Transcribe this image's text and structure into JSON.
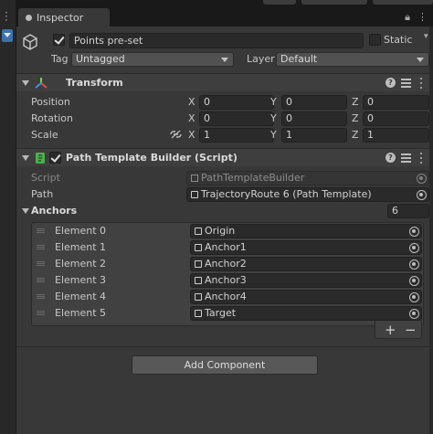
{
  "tab": {
    "title": "Inspector"
  },
  "object": {
    "name": "Points pre-set",
    "static_label": "Static",
    "tag_label": "Tag",
    "tag_value": "Untagged",
    "layer_label": "Layer",
    "layer_value": "Default"
  },
  "transform": {
    "title": "Transform",
    "rows": [
      {
        "label": "Position",
        "x": "0",
        "y": "0",
        "z": "0"
      },
      {
        "label": "Rotation",
        "x": "0",
        "y": "0",
        "z": "0"
      },
      {
        "label": "Scale",
        "x": "1",
        "y": "1",
        "z": "1"
      }
    ],
    "axis": {
      "x": "X",
      "y": "Y",
      "z": "Z"
    }
  },
  "script_component": {
    "title": "Path Template Builder (Script)",
    "script_label": "Script",
    "script_value": "PathTemplateBuilder",
    "path_label": "Path",
    "path_value": "TrajectoryRoute 6 (Path Template)",
    "anchors_label": "Anchors",
    "anchors_count": "6",
    "elements": [
      {
        "label": "Element 0",
        "value": "Origin"
      },
      {
        "label": "Element 1",
        "value": "Anchor1"
      },
      {
        "label": "Element 2",
        "value": "Anchor2"
      },
      {
        "label": "Element 3",
        "value": "Anchor3"
      },
      {
        "label": "Element 4",
        "value": "Anchor4"
      },
      {
        "label": "Element 5",
        "value": "Target"
      }
    ],
    "plus": "+",
    "minus": "−"
  },
  "add_component": "Add Component",
  "colors": {
    "panel": "#383838",
    "header": "#3e3e3e",
    "field": "#2a2a2a",
    "accent": "#3a72b0"
  }
}
